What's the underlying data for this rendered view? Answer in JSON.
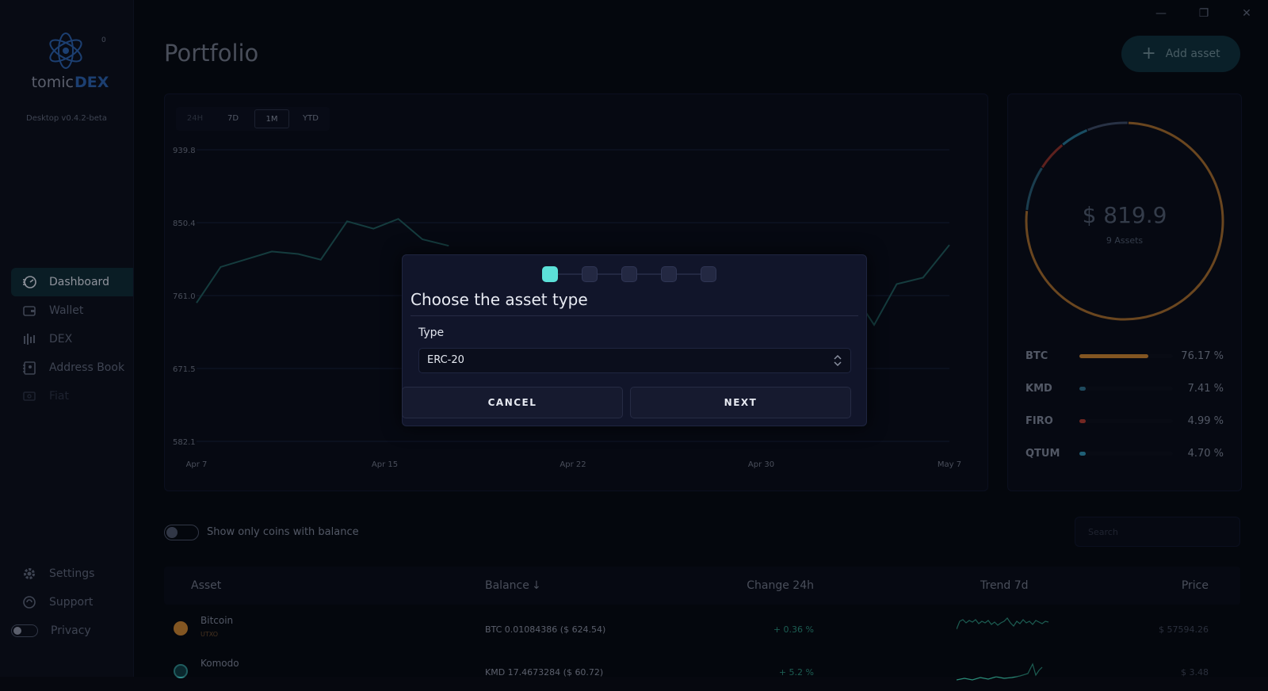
{
  "window": {
    "minimize": "—",
    "maximize": "❐",
    "close": "✕"
  },
  "sidebar": {
    "logo_text_a": "atomic",
    "logo_text_b": "DEX",
    "badge": "0",
    "version": "Desktop v0.4.2-beta",
    "items": [
      {
        "label": "Dashboard",
        "icon": "dashboard-icon"
      },
      {
        "label": "Wallet",
        "icon": "wallet-icon"
      },
      {
        "label": "DEX",
        "icon": "dex-icon"
      },
      {
        "label": "Address Book",
        "icon": "address-book-icon"
      },
      {
        "label": "Fiat",
        "icon": "fiat-icon"
      }
    ],
    "bottom": [
      {
        "label": "Settings",
        "icon": "gear-icon"
      },
      {
        "label": "Support",
        "icon": "support-icon"
      },
      {
        "label": "Privacy",
        "icon": "privacy-toggle"
      }
    ]
  },
  "header": {
    "title": "Portfolio",
    "add_asset": "Add asset",
    "add_icon": "+"
  },
  "chart": {
    "periods": [
      "24H",
      "7D",
      "1M",
      "YTD"
    ],
    "selected_period": "1M"
  },
  "chart_data": {
    "type": "line",
    "x_ticks": [
      "Apr 7",
      "Apr 15",
      "Apr 22",
      "Apr 30",
      "May 7"
    ],
    "y_ticks": [
      "939.8",
      "850.4",
      "761.0",
      "671.5",
      "582.1"
    ],
    "ylim": [
      582.1,
      939.8
    ],
    "series": [
      {
        "values_visible": [
          {
            "x": 0.0,
            "y": 752
          },
          {
            "x": 0.032,
            "y": 796
          },
          {
            "x": 0.1,
            "y": 815
          },
          {
            "x": 0.135,
            "y": 812
          },
          {
            "x": 0.165,
            "y": 805
          },
          {
            "x": 0.2,
            "y": 852
          },
          {
            "x": 0.235,
            "y": 843
          },
          {
            "x": 0.268,
            "y": 855
          },
          {
            "x": 0.3,
            "y": 830
          },
          {
            "x": 0.335,
            "y": 822
          },
          {
            "x": 0.87,
            "y": 767
          },
          {
            "x": 0.9,
            "y": 725
          },
          {
            "x": 0.93,
            "y": 775
          },
          {
            "x": 0.965,
            "y": 783
          },
          {
            "x": 1.0,
            "y": 823
          }
        ]
      }
    ]
  },
  "portfolio": {
    "total": "$ 819.9",
    "assets_count": "9 Assets",
    "allocations": [
      {
        "name": "BTC",
        "pct": "76.17 %",
        "fraction": 0.7617,
        "color": "#c8812f"
      },
      {
        "name": "KMD",
        "pct": "7.41 %",
        "fraction": 0.0741,
        "color": "#2f6f8a"
      },
      {
        "name": "FIRO",
        "pct": "4.99 %",
        "fraction": 0.0499,
        "color": "#b03a2e"
      },
      {
        "name": "QTUM",
        "pct": "4.70 %",
        "fraction": 0.047,
        "color": "#2e8fb0"
      }
    ]
  },
  "filter": {
    "toggle_label": "Show only coins with balance",
    "search_placeholder": "Search"
  },
  "table": {
    "headers": {
      "asset": "Asset",
      "balance": "Balance",
      "change": "Change 24h",
      "trend": "Trend 7d",
      "price": "Price"
    },
    "sort_icon": "↓",
    "rows": [
      {
        "name": "Bitcoin",
        "type": "UTXO",
        "balance": "BTC 0.01084386 ($ 624.54)",
        "change": "+ 0.36 %",
        "price": "$ 57594.26",
        "color": "#c8812f"
      },
      {
        "name": "Komodo",
        "type": "",
        "balance": "KMD 17.4673284 ($ 60.72)",
        "change": "+ 5.2 %",
        "price": "$ 3.48",
        "color": "#2f8a8a"
      }
    ]
  },
  "modal": {
    "title": "Choose the asset type",
    "type_label": "Type",
    "type_value": "ERC-20",
    "cancel": "CANCEL",
    "next": "NEXT",
    "steps_total": 5,
    "current_step": 1
  }
}
